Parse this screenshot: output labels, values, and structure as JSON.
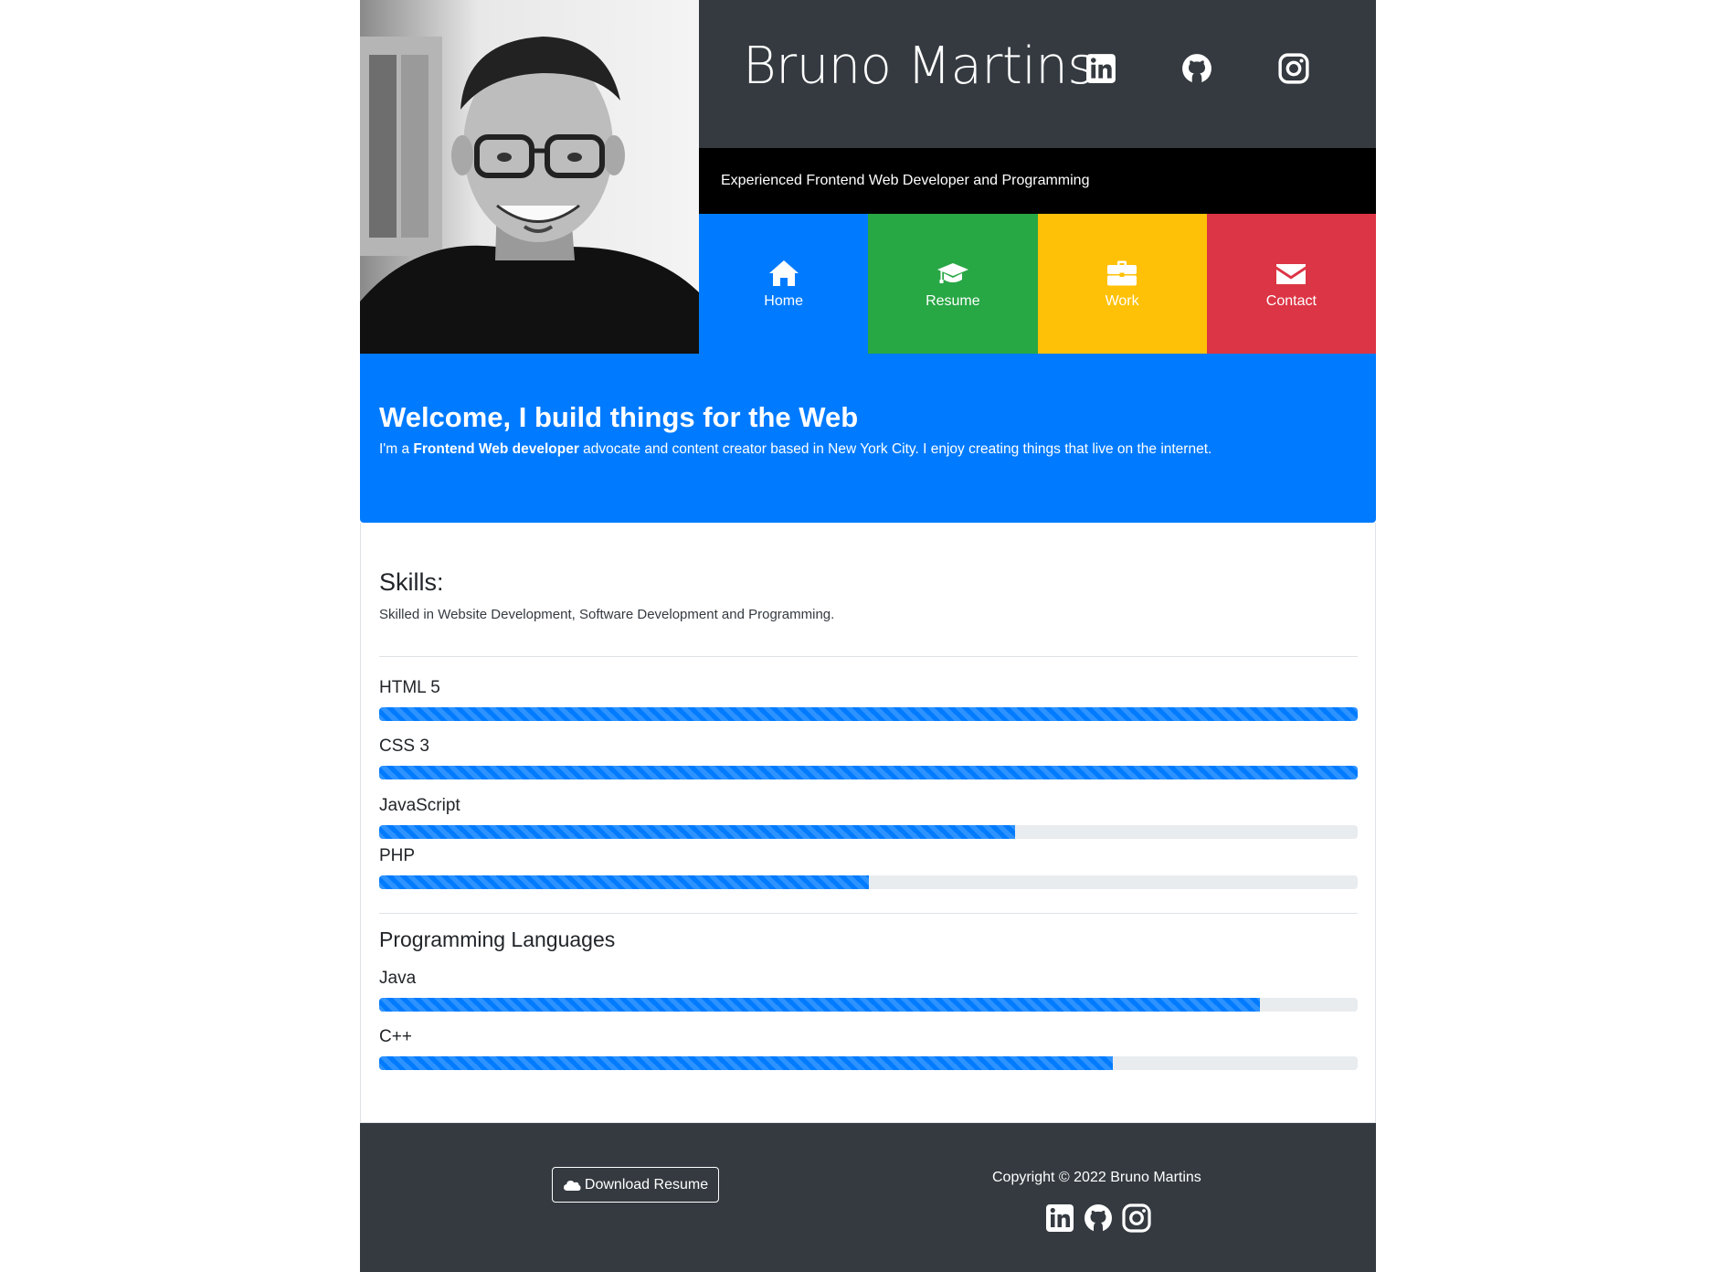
{
  "header": {
    "name": "Bruno Martins",
    "tagline": "Experienced Frontend Web Developer and Programming",
    "social_icons": [
      "linkedin-icon",
      "github-icon",
      "instagram-icon"
    ]
  },
  "nav": [
    {
      "label": "Home",
      "icon": "home-icon",
      "color": "#007bff"
    },
    {
      "label": "Resume",
      "icon": "graduation-cap-icon",
      "color": "#28a745"
    },
    {
      "label": "Work",
      "icon": "briefcase-icon",
      "color": "#ffc107"
    },
    {
      "label": "Contact",
      "icon": "envelope-icon",
      "color": "#dc3545"
    }
  ],
  "welcome": {
    "title": "Welcome, I build things for the Web",
    "text_prefix": "I'm a ",
    "text_bold": "Frontend Web developer",
    "text_suffix": " advocate and content creator based in New York City. I enjoy creating things that live on the internet."
  },
  "skills": {
    "title": "Skills:",
    "description": "Skilled in Website Development, Software Development and Programming.",
    "items": [
      {
        "label": "HTML 5",
        "percent": 100
      },
      {
        "label": "CSS 3",
        "percent": 100
      },
      {
        "label": "JavaScript",
        "percent": 65
      },
      {
        "label": "PHP",
        "percent": 50
      }
    ]
  },
  "programming": {
    "title": "Programming Languages",
    "items": [
      {
        "label": "Java",
        "percent": 90
      },
      {
        "label": "C++",
        "percent": 75
      }
    ]
  },
  "footer": {
    "download_label": "Download Resume",
    "copyright": "Copyright © 2022 Bruno Martins"
  },
  "colors": {
    "accent": "#007bff",
    "dark": "#343a40"
  }
}
